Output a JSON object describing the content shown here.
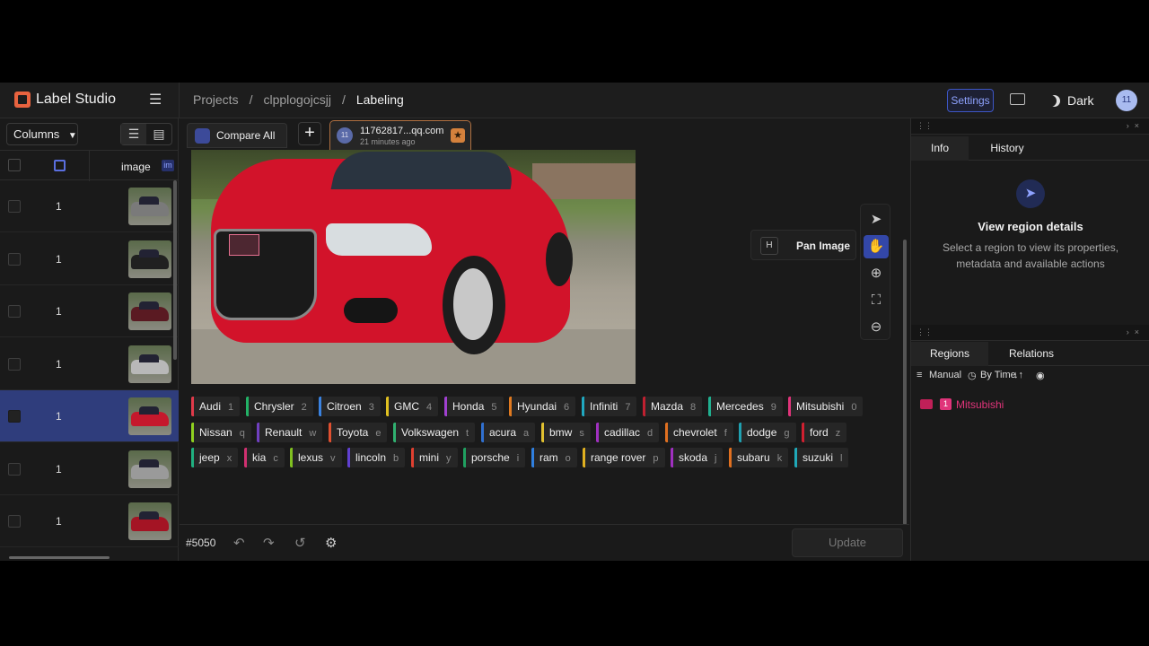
{
  "app": {
    "name": "Label Studio"
  },
  "breadcrumb": [
    "Projects",
    "clpplogojcsjj",
    "Labeling"
  ],
  "header": {
    "settings_label": "Settings",
    "theme_label": "Dark",
    "avatar_initials": "11"
  },
  "left": {
    "columns_label": "Columns",
    "image_col": "image",
    "image_col_tag": "im",
    "rows": [
      {
        "num": "1",
        "color": "#7a7a7a"
      },
      {
        "num": "1",
        "color": "#202020"
      },
      {
        "num": "1",
        "color": "#5a1a22"
      },
      {
        "num": "1",
        "color": "#b8b8b8"
      },
      {
        "num": "1",
        "color": "#c5182c",
        "selected": true
      },
      {
        "num": "1",
        "color": "#9a9a9a"
      },
      {
        "num": "1",
        "color": "#a41424"
      }
    ]
  },
  "tabs": {
    "compare_label": "Compare All",
    "annotation": {
      "avatar": "11",
      "email": "11762817...qq.com",
      "time": "21 minutes ago"
    }
  },
  "tools": {
    "tooltip_key": "H",
    "tooltip_label": "Pan Image"
  },
  "labels": [
    {
      "name": "Audi",
      "key": "1",
      "color": "#e03a4a"
    },
    {
      "name": "Chrysler",
      "key": "2",
      "color": "#22b266"
    },
    {
      "name": "Citroen",
      "key": "3",
      "color": "#3a82e0"
    },
    {
      "name": "GMC",
      "key": "4",
      "color": "#e0c020"
    },
    {
      "name": "Honda",
      "key": "5",
      "color": "#a040d0"
    },
    {
      "name": "Hyundai",
      "key": "6",
      "color": "#e07a20"
    },
    {
      "name": "Infiniti",
      "key": "7",
      "color": "#20a8c0"
    },
    {
      "name": "Mazda",
      "key": "8",
      "color": "#c02030"
    },
    {
      "name": "Mercedes",
      "key": "9",
      "color": "#20b090"
    },
    {
      "name": "Mitsubishi",
      "key": "0",
      "color": "#e0347a"
    },
    {
      "name": "Nissan",
      "key": "q",
      "color": "#90d020"
    },
    {
      "name": "Renault",
      "key": "w",
      "color": "#7040c0"
    },
    {
      "name": "Toyota",
      "key": "e",
      "color": "#e05030"
    },
    {
      "name": "Volkswagen",
      "key": "t",
      "color": "#30b070"
    },
    {
      "name": "acura",
      "key": "a",
      "color": "#3070d0"
    },
    {
      "name": "bmw",
      "key": "s",
      "color": "#e0c030"
    },
    {
      "name": "cadillac",
      "key": "d",
      "color": "#a030c0"
    },
    {
      "name": "chevrolet",
      "key": "f",
      "color": "#e07020"
    },
    {
      "name": "dodge",
      "key": "g",
      "color": "#20a0b0"
    },
    {
      "name": "ford",
      "key": "z",
      "color": "#d02030"
    },
    {
      "name": "jeep",
      "key": "x",
      "color": "#20b080"
    },
    {
      "name": "kia",
      "key": "c",
      "color": "#d03070"
    },
    {
      "name": "lexus",
      "key": "v",
      "color": "#80c020"
    },
    {
      "name": "lincoln",
      "key": "b",
      "color": "#6040d0"
    },
    {
      "name": "mini",
      "key": "y",
      "color": "#e04030"
    },
    {
      "name": "porsche",
      "key": "i",
      "color": "#20a060"
    },
    {
      "name": "ram",
      "key": "o",
      "color": "#3080e0"
    },
    {
      "name": "range rover",
      "key": "p",
      "color": "#e0b020"
    },
    {
      "name": "skoda",
      "key": "j",
      "color": "#a030c0"
    },
    {
      "name": "subaru",
      "key": "k",
      "color": "#e07020"
    },
    {
      "name": "suzuki",
      "key": "l",
      "color": "#20a8b8"
    }
  ],
  "bottom": {
    "task_id": "#5050",
    "update_label": "Update"
  },
  "right": {
    "info_tab": "Info",
    "history_tab": "History",
    "info_title": "View region details",
    "info_desc": "Select a region to view its properties, metadata and available actions",
    "regions_tab": "Regions",
    "relations_tab": "Relations",
    "manual_label": "Manual",
    "bytime_label": "By Time",
    "region": {
      "index": "1",
      "label": "Mitsubishi",
      "color": "#e0347a"
    }
  }
}
